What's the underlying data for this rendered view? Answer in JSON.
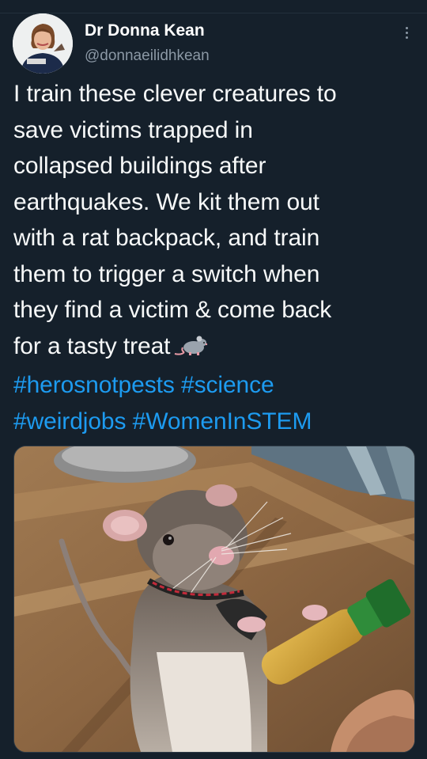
{
  "tweet": {
    "author_name": "Dr Donna Kean",
    "author_handle": "@donnaeilidhkean",
    "text_lines": [
      "I train these clever creatures to",
      "save victims trapped in",
      "collapsed buildings after",
      "earthquakes. We kit them out",
      "with a rat backpack, and train",
      "them to trigger a switch when",
      "they find a victim & come back",
      "for a tasty treat"
    ],
    "emoji": "rat",
    "hashtags_line1": [
      "#herosnotpests",
      "#science"
    ],
    "hashtags_line2": [
      "#weirdjobs",
      "#WomenInSTEM"
    ],
    "media_description": "giant pouched rat holding a food tube"
  },
  "colors": {
    "background": "#15202b",
    "hashtag": "#1d9bf0",
    "secondary_text": "#8b98a5",
    "primary_text": "#f7f9f9"
  },
  "icons": {
    "more": "more-vertical-icon",
    "emoji": "rat-emoji-icon"
  }
}
